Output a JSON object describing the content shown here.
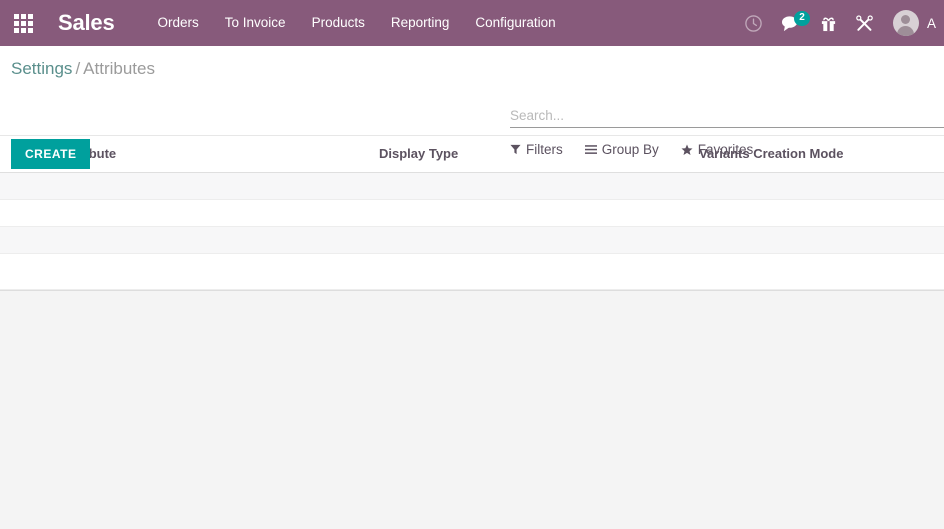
{
  "navbar": {
    "apps_icon": "apps-grid-icon",
    "brand": "Sales",
    "menu_items": [
      {
        "label": "Orders"
      },
      {
        "label": "To Invoice"
      },
      {
        "label": "Products"
      },
      {
        "label": "Reporting"
      },
      {
        "label": "Configuration"
      }
    ],
    "icons": [
      {
        "name": "clock-icon",
        "title": "Activities"
      },
      {
        "name": "chat-icon",
        "title": "Messages",
        "badge": "2"
      },
      {
        "name": "gift-icon",
        "title": "Gift"
      },
      {
        "name": "tools-icon",
        "title": "Developer Tools"
      }
    ],
    "user": {
      "avatar": "user-avatar",
      "name": "A"
    },
    "background_color": "#875A7B",
    "badge_color": "#00A09D"
  },
  "control_panel": {
    "breadcrumb": {
      "root": "Settings",
      "separator": "/",
      "current": "Attributes"
    },
    "create_label": "CREATE",
    "create_color": "#00A09D",
    "search": {
      "placeholder": "Search...",
      "value": ""
    },
    "search_options": [
      {
        "label": "Filters",
        "icon": "filter-icon"
      },
      {
        "label": "Group By",
        "icon": "list-icon"
      },
      {
        "label": "Favorites",
        "icon": "star-icon"
      }
    ]
  },
  "list_view": {
    "select_all": "select-all-checkbox",
    "columns": [
      {
        "label": "Attribute"
      },
      {
        "label": "Display Type"
      },
      {
        "label": "Variants Creation Mode"
      }
    ],
    "rows": [
      {
        "style": "shaded"
      },
      {
        "style": "plain"
      },
      {
        "style": "shaded"
      },
      {
        "style": "plain"
      }
    ]
  },
  "colors": {
    "brand_purple": "#875A7B",
    "accent_teal": "#00A09D",
    "page_background": "#F4F4F4",
    "row_shaded": "#F7F7F8"
  }
}
